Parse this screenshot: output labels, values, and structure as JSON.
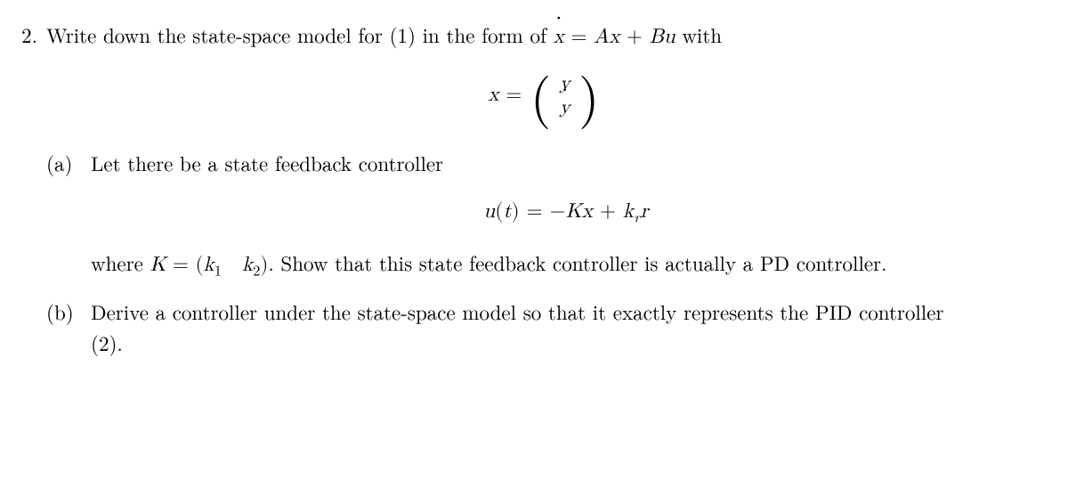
{
  "problem": {
    "number": "2.",
    "prompt_prefix": "Write down the state-space model for (1) in the form of ",
    "prompt_eq_lhs": "x",
    "prompt_eq_eq": " = ",
    "prompt_eq_rhs_A": "Ax",
    "prompt_eq_plus": " + ",
    "prompt_eq_rhs_B": "Bu",
    "prompt_suffix": " with",
    "state_def": {
      "lhs": "x",
      "eq": " = ",
      "row1": "y",
      "row2": "y"
    },
    "parts": {
      "a": {
        "label": "(a)",
        "intro": "Let there be a state feedback controller",
        "ctrl_eq": {
          "lhs": "u(t)",
          "eq": " = ",
          "neg": "−",
          "K": "K",
          "x": "x",
          "plus": " + ",
          "k": "k",
          "ksub": "r",
          "r": "r"
        },
        "after_prefix": "where ",
        "K": "K",
        "Keq": " = (",
        "k1": "k",
        "k1sub": "1",
        "ksp": " ",
        "k2": "k",
        "k2sub": "2",
        "Kclose": ").",
        "after_suffix": " Show that this state feedback controller is actually a PD controller."
      },
      "b": {
        "label": "(b)",
        "text_line1": "Derive a controller under the state-space model so that it exactly represents the PID controller",
        "text_line2": "(2)."
      }
    }
  }
}
